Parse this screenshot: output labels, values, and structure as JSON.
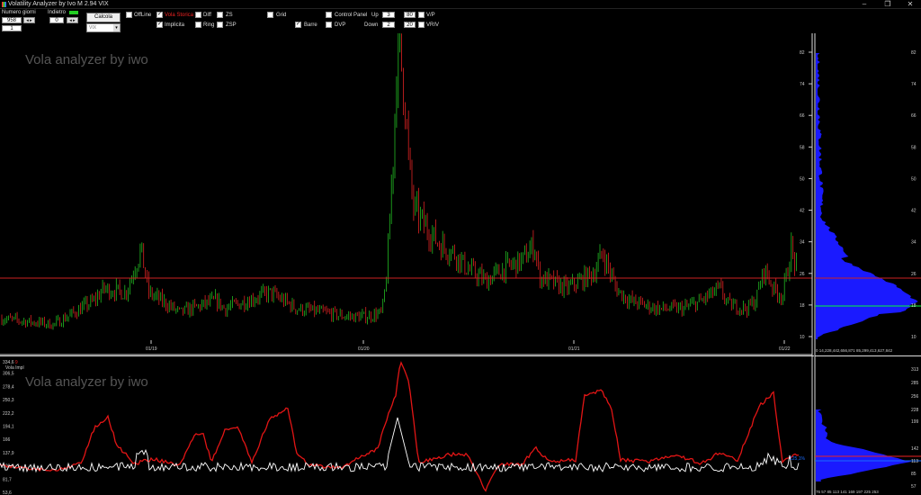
{
  "window": {
    "title": "Volatility Analyzer by Ivo M 2.94  VIX",
    "minimize": "–",
    "maximize": "❐",
    "close": "✕"
  },
  "controls": {
    "numero_giorni_label": "Numero giorni",
    "numero_giorni_value": "958",
    "second_value": "1",
    "indietro_label": "Indietro",
    "indietro_value": "0",
    "calcola_label": "Calcola",
    "ticker_select": "VIX",
    "offline_label": "OffLine",
    "vola_storica_label": "Vola Storica",
    "implicita_label": "Implicita",
    "diff_label": "Diff",
    "ring_label": "Ring",
    "zs_label": "ZS",
    "zsp_label": "ZSP",
    "grid_label": "Grid",
    "barre_label": "Barre",
    "control_panel_label": "Control Panel",
    "dvp_label": "DVP",
    "up_label": "Up",
    "up_value": "3",
    "up_value2": "80",
    "down_label": "Down",
    "down_value": "2",
    "down_value2": "20",
    "vp_label": "V/P",
    "vriv_label": "VRIV",
    "vola_storica_checked": true,
    "implicita_checked": true,
    "barre_checked": true
  },
  "top_chart": {
    "watermark": "Vola analyzer by iwo",
    "y_ticks": [
      "82",
      "74",
      "66",
      "58",
      "50",
      "42",
      "34",
      "26",
      "18",
      "10"
    ],
    "x_ticks": [
      "01/19",
      "01/20",
      "01/21",
      "01/22"
    ],
    "ref_level": 26,
    "histogram_x_ticks": "0  14,228,442,656,871   85,299,413,627,842",
    "histogram_ref_red": 26,
    "histogram_ref_green": 18
  },
  "bottom_chart": {
    "watermark": "Vola analyzer by iwo",
    "legend_top": "334,6 ",
    "legend_top_red": "9",
    "legend_sub": "Vola Impl",
    "y_ticks": [
      "306,5",
      "278,4",
      "250,3",
      "222,2",
      "194,1",
      "166",
      "137,9",
      "109,8",
      "81,7",
      "53,6"
    ],
    "right_y_ticks": [
      "313",
      "285",
      "256",
      "228",
      "199",
      "142",
      "113",
      "85",
      "57"
    ],
    "hist_x_ticks": "  76  57  85  113  141  169  197  225  253",
    "current_label": "125,1%"
  },
  "colors": {
    "up_candle": "#22bb22",
    "down_candle": "#dd2222",
    "ref_line": "#cc2222",
    "hist_blue": "#1a1aff",
    "green_line": "#00ff33",
    "bg": "#000000"
  }
}
